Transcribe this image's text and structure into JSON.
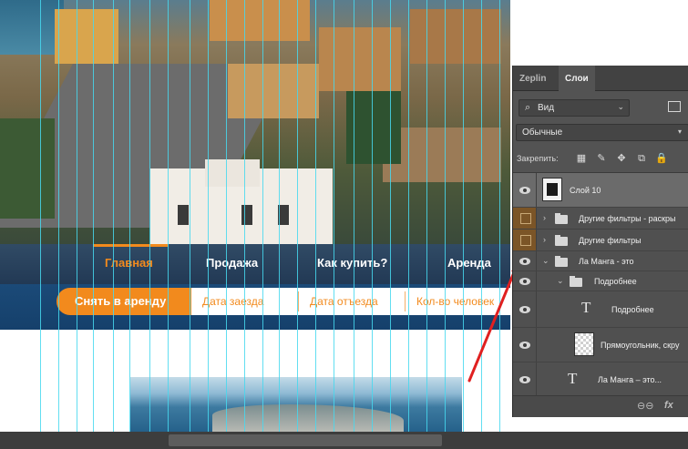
{
  "website": {
    "nav": {
      "items": [
        "Главная",
        "Продажа",
        "Как купить?",
        "Аренда"
      ],
      "active": "Главная"
    },
    "search": {
      "rent_button": "Снять в аренду",
      "checkin": "Дата заезда",
      "checkout": "Дата отъезда",
      "people": "Кол-во человек"
    }
  },
  "photoshop_panel": {
    "tabs": [
      "Zeplin",
      "Слои"
    ],
    "active_tab": "Слои",
    "kind_filter": "Вид",
    "blend_mode": "Обычные",
    "lock_label": "Закрепить:",
    "layers": [
      {
        "name": "Слой 10",
        "type": "image",
        "visible": true,
        "selected": true
      },
      {
        "name": "Другие фильтры - раскры",
        "type": "group",
        "visible": false,
        "indent": 0
      },
      {
        "name": "Другие фильтры",
        "type": "group",
        "visible": false,
        "indent": 0
      },
      {
        "name": "Ла Манга - это",
        "type": "group",
        "visible": true,
        "indent": 0,
        "expanded": true
      },
      {
        "name": "Подробнее",
        "type": "group",
        "visible": true,
        "indent": 1,
        "expanded": true
      },
      {
        "name": "Подробнее",
        "type": "text",
        "visible": true,
        "indent": 2
      },
      {
        "name": "Прямоугольник, скру",
        "type": "shape",
        "visible": true,
        "indent": 2
      },
      {
        "name": "Ла Манга – это...",
        "type": "text",
        "visible": true,
        "indent": 1
      }
    ],
    "bottom_icons": [
      "link-icon",
      "fx-icon"
    ],
    "fx_label": "fx"
  },
  "colors": {
    "accent_orange": "#f28a1d",
    "nav_blue": "#15406b",
    "guide_cyan": "#47d8ee",
    "annotation_red": "#e02020",
    "panel_bg": "#535353"
  }
}
